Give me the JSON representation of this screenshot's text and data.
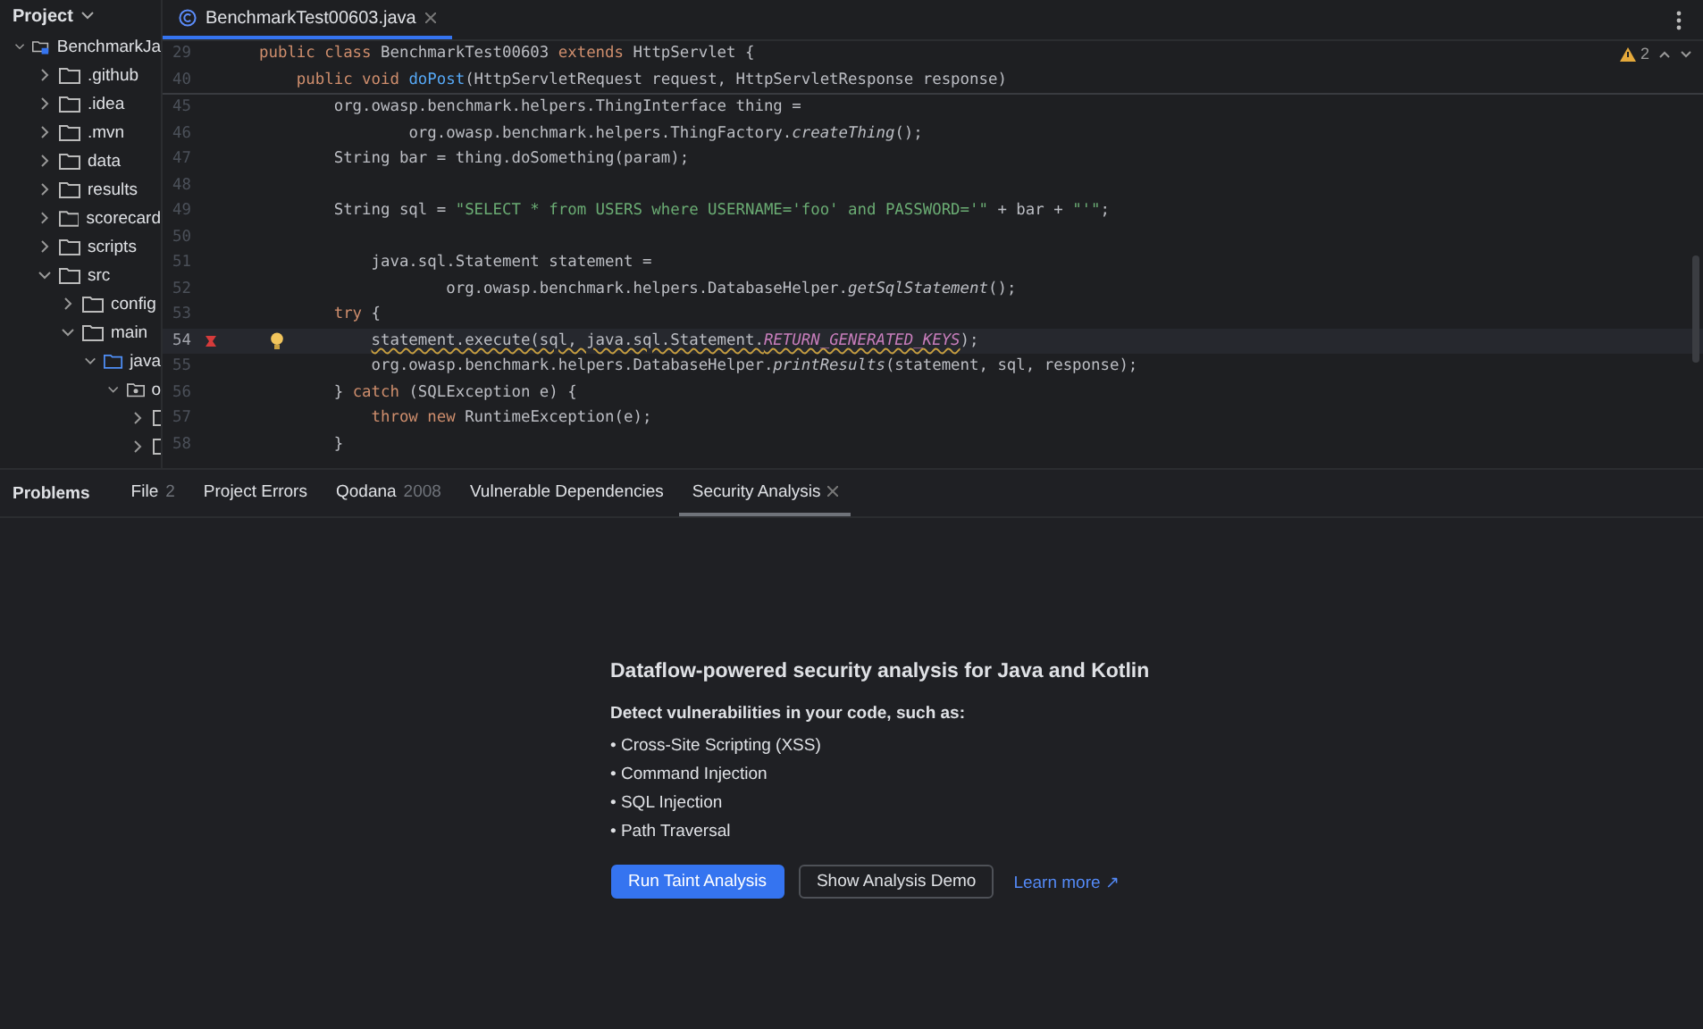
{
  "sidebar": {
    "title": "Project",
    "tree": [
      {
        "label": "BenchmarkJa",
        "kind": "module",
        "expanded": true,
        "children": [
          {
            "label": ".github",
            "kind": "folder",
            "expanded": false
          },
          {
            "label": ".idea",
            "kind": "folder",
            "expanded": false
          },
          {
            "label": ".mvn",
            "kind": "folder",
            "expanded": false
          },
          {
            "label": "data",
            "kind": "folder",
            "expanded": false
          },
          {
            "label": "results",
            "kind": "folder",
            "expanded": false
          },
          {
            "label": "scorecard",
            "kind": "folder",
            "expanded": false
          },
          {
            "label": "scripts",
            "kind": "folder",
            "expanded": false
          },
          {
            "label": "src",
            "kind": "folder",
            "expanded": true,
            "children": [
              {
                "label": "config",
                "kind": "folder",
                "expanded": false
              },
              {
                "label": "main",
                "kind": "folder",
                "expanded": true,
                "children": [
                  {
                    "label": "java",
                    "kind": "source",
                    "expanded": true,
                    "children": [
                      {
                        "label": "o",
                        "kind": "package",
                        "expanded": true,
                        "children": [
                          {
                            "kind": "class",
                            "expanded": false
                          },
                          {
                            "kind": "class",
                            "expanded": false
                          }
                        ]
                      }
                    ]
                  }
                ]
              }
            ]
          }
        ]
      }
    ]
  },
  "editor": {
    "tabs": [
      {
        "label": "BenchmarkTest00603.java",
        "selected": true
      }
    ],
    "warnings": "2",
    "sticky_lines": [
      {
        "number": "29",
        "tokens": [
          {
            "text": "public class ",
            "kind": "kw"
          },
          {
            "text": "BenchmarkTest00603 ",
            "kind": "plain"
          },
          {
            "text": "extends ",
            "kind": "kw"
          },
          {
            "text": "HttpServlet {",
            "kind": "plain"
          }
        ]
      },
      {
        "number": "40",
        "tokens": [
          {
            "text": "    public void ",
            "kind": "kw"
          },
          {
            "text": "doPost",
            "kind": "fn"
          },
          {
            "text": "(HttpServletRequest request, HttpServletResponse response)",
            "kind": "plain"
          }
        ]
      }
    ],
    "lines": [
      {
        "number": "45",
        "current": false,
        "marker": false,
        "bulb": false,
        "tokens": [
          {
            "text": "        org.owasp.benchmark.helpers.ThingInterface thing =",
            "kind": "plain"
          }
        ]
      },
      {
        "number": "46",
        "current": false,
        "marker": false,
        "bulb": false,
        "tokens": [
          {
            "text": "                org.owasp.benchmark.helpers.ThingFactory.",
            "kind": "plain"
          },
          {
            "text": "createThing",
            "kind": "it"
          },
          {
            "text": "();",
            "kind": "plain"
          }
        ]
      },
      {
        "number": "47",
        "current": false,
        "marker": false,
        "bulb": false,
        "tokens": [
          {
            "text": "        String bar = thing.doSomething(param);",
            "kind": "plain"
          }
        ]
      },
      {
        "number": "48",
        "current": false
      },
      {
        "number": "49",
        "current": false,
        "marker": false,
        "bulb": false,
        "tokens": [
          {
            "text": "        String sql = ",
            "kind": "plain"
          },
          {
            "text": "\"SELECT * from USERS where USERNAME='foo' and PASSWORD='\"",
            "kind": "str"
          },
          {
            "text": " + bar + ",
            "kind": "plain"
          },
          {
            "text": "\"'\"",
            "kind": "str"
          },
          {
            "text": ";",
            "kind": "plain"
          }
        ]
      },
      {
        "number": "50",
        "current": false
      },
      {
        "number": "51",
        "current": false,
        "marker": false,
        "bulb": false,
        "tokens": [
          {
            "text": "            java.sql.Statement statement =",
            "kind": "plain"
          }
        ]
      },
      {
        "number": "52",
        "current": false,
        "marker": false,
        "bulb": false,
        "tokens": [
          {
            "text": "                    org.owasp.benchmark.helpers.DatabaseHelper.",
            "kind": "plain"
          },
          {
            "text": "getSqlStatement",
            "kind": "it"
          },
          {
            "text": "();",
            "kind": "plain"
          }
        ]
      },
      {
        "number": "53",
        "current": false,
        "marker": false,
        "bulb": false,
        "tokens": [
          {
            "text": "        try ",
            "kind": "kw"
          },
          {
            "text": "{",
            "kind": "plain"
          }
        ]
      },
      {
        "number": "54",
        "current": true,
        "marker": true,
        "bulb": true,
        "tokens": [
          {
            "text": "            statement.execute(sql, java.sql.Statement.",
            "kind": "squiggle"
          },
          {
            "text": "RETURN_GENERATED_KEYS",
            "kind": "const"
          },
          {
            "text": ");",
            "kind": "plain"
          }
        ]
      },
      {
        "number": "55",
        "current": false,
        "marker": false,
        "bulb": false,
        "tokens": [
          {
            "text": "            org.owasp.benchmark.helpers.DatabaseHelper.",
            "kind": "plain"
          },
          {
            "text": "printResults",
            "kind": "it"
          },
          {
            "text": "(statement, sql, response);",
            "kind": "plain"
          }
        ]
      },
      {
        "number": "56",
        "current": false,
        "marker": false,
        "bulb": false,
        "tokens": [
          {
            "text": "        } ",
            "kind": "plain"
          },
          {
            "text": "catch ",
            "kind": "kw"
          },
          {
            "text": "(SQLException e) {",
            "kind": "plain"
          }
        ]
      },
      {
        "number": "57",
        "current": false,
        "marker": false,
        "bulb": false,
        "tokens": [
          {
            "text": "            throw new ",
            "kind": "kw"
          },
          {
            "text": "RuntimeException(e);",
            "kind": "plain"
          }
        ]
      },
      {
        "number": "58",
        "current": false,
        "marker": false,
        "bulb": false,
        "tokens": [
          {
            "text": "        }",
            "kind": "plain"
          }
        ]
      }
    ]
  },
  "problems": {
    "title": "Problems",
    "tabs": [
      {
        "label": "File",
        "count": "2",
        "selected": false,
        "closable": false
      },
      {
        "label": "Project Errors",
        "selected": false,
        "closable": false
      },
      {
        "label": "Qodana",
        "count": "2008",
        "selected": false,
        "closable": false
      },
      {
        "label": "Vulnerable Dependencies",
        "selected": false,
        "closable": false
      },
      {
        "label": "Security Analysis",
        "selected": true,
        "closable": true
      }
    ],
    "heading": "Dataflow-powered security analysis for Java and Kotlin",
    "intro": "Detect vulnerabilities in your code, such as:",
    "bullets": [
      "• Cross-Site Scripting (XSS)",
      "• Command Injection",
      "• SQL Injection",
      "• Path Traversal"
    ],
    "buttons": [
      {
        "label": "Run Taint Analysis",
        "kind": "primary"
      },
      {
        "label": "Show Analysis Demo",
        "kind": "secondary"
      }
    ],
    "link": "Learn more ↗"
  }
}
